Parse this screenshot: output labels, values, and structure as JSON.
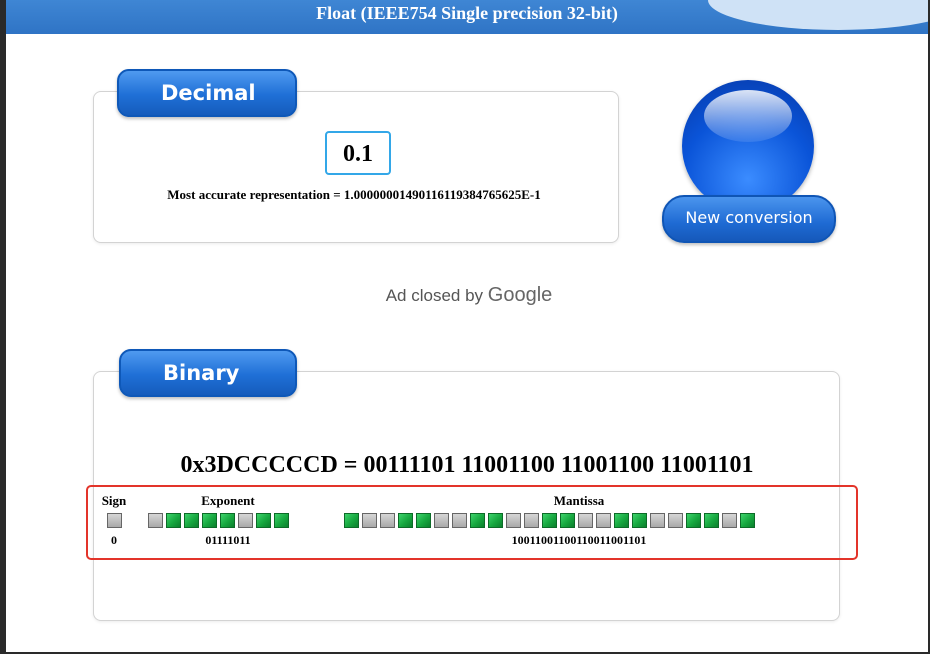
{
  "window": {
    "title": "Float (IEEE754 Single precision 32-bit)"
  },
  "decimal": {
    "tab_label": "Decimal",
    "value": "0.1",
    "accurate_text": "Most accurate representation = 1.00000001490116119384765625E-1"
  },
  "new_conversion_label": "New conversion",
  "ad": {
    "prefix": "Ad closed by",
    "brand": "Google"
  },
  "binary": {
    "tab_label": "Binary",
    "hex_line": "0x3DCCCCCD = 00111101 11001100 11001100 11001101",
    "sign": {
      "label": "Sign",
      "value": "0",
      "bits": [
        0
      ]
    },
    "exponent": {
      "label": "Exponent",
      "value": "01111011",
      "bits": [
        0,
        1,
        1,
        1,
        1,
        0,
        1,
        1
      ]
    },
    "mantissa": {
      "label": "Mantissa",
      "value": "10011001100110011001101",
      "bits": [
        1,
        0,
        0,
        1,
        1,
        0,
        0,
        1,
        1,
        0,
        0,
        1,
        1,
        0,
        0,
        1,
        1,
        0,
        0,
        1,
        1,
        0,
        1
      ]
    }
  },
  "colors": {
    "title_bar": "#2f74c5",
    "tab_blue": "#1f6fd6",
    "bit_on": "#16a73f",
    "bit_off": "#b5b5b5",
    "highlight_box": "#e3342a",
    "input_border": "#33a7e8"
  }
}
